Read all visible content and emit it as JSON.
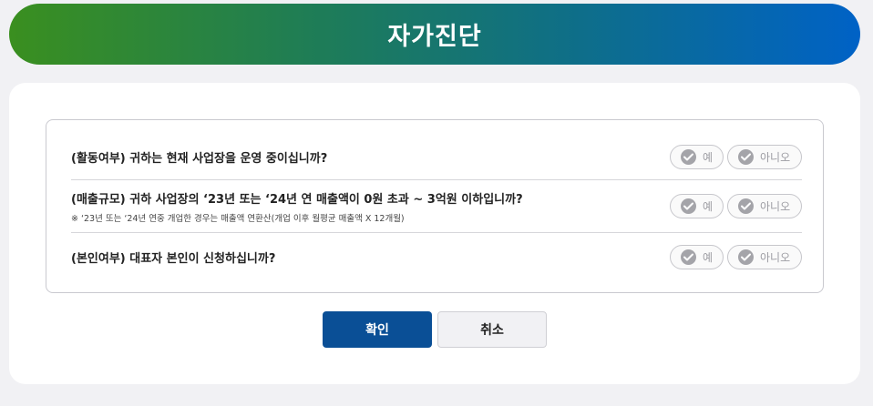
{
  "header": {
    "title": "자가진단"
  },
  "questions": [
    {
      "text": "(활동여부) 귀하는 현재 사업장을 운영 중이십니까?",
      "note": "",
      "yes_label": "예",
      "no_label": "아니오"
    },
    {
      "text": "(매출규모) 귀하 사업장의 ‘23년 또는 ‘24년 연 매출액이 0원 초과 ~ 3억원 이하입니까?",
      "note": "※ ‘23년 또는 ‘24년 연중 개업한 경우는 매출액 연환산(개업 이후 월평균 매출액 X 12개월)",
      "yes_label": "예",
      "no_label": "아니오"
    },
    {
      "text": "(본인여부) 대표자 본인이 신청하십니까?",
      "note": "",
      "yes_label": "예",
      "no_label": "아니오"
    }
  ],
  "buttons": {
    "confirm_label": "확인",
    "cancel_label": "취소"
  },
  "colors": {
    "title_gradient_start": "#3a8f1f",
    "title_gradient_end": "#0062c6",
    "confirm_button": "#0a4f96",
    "option_gray": "#a4a4a9"
  },
  "icons": {
    "option_icon": "check-circle-icon"
  }
}
